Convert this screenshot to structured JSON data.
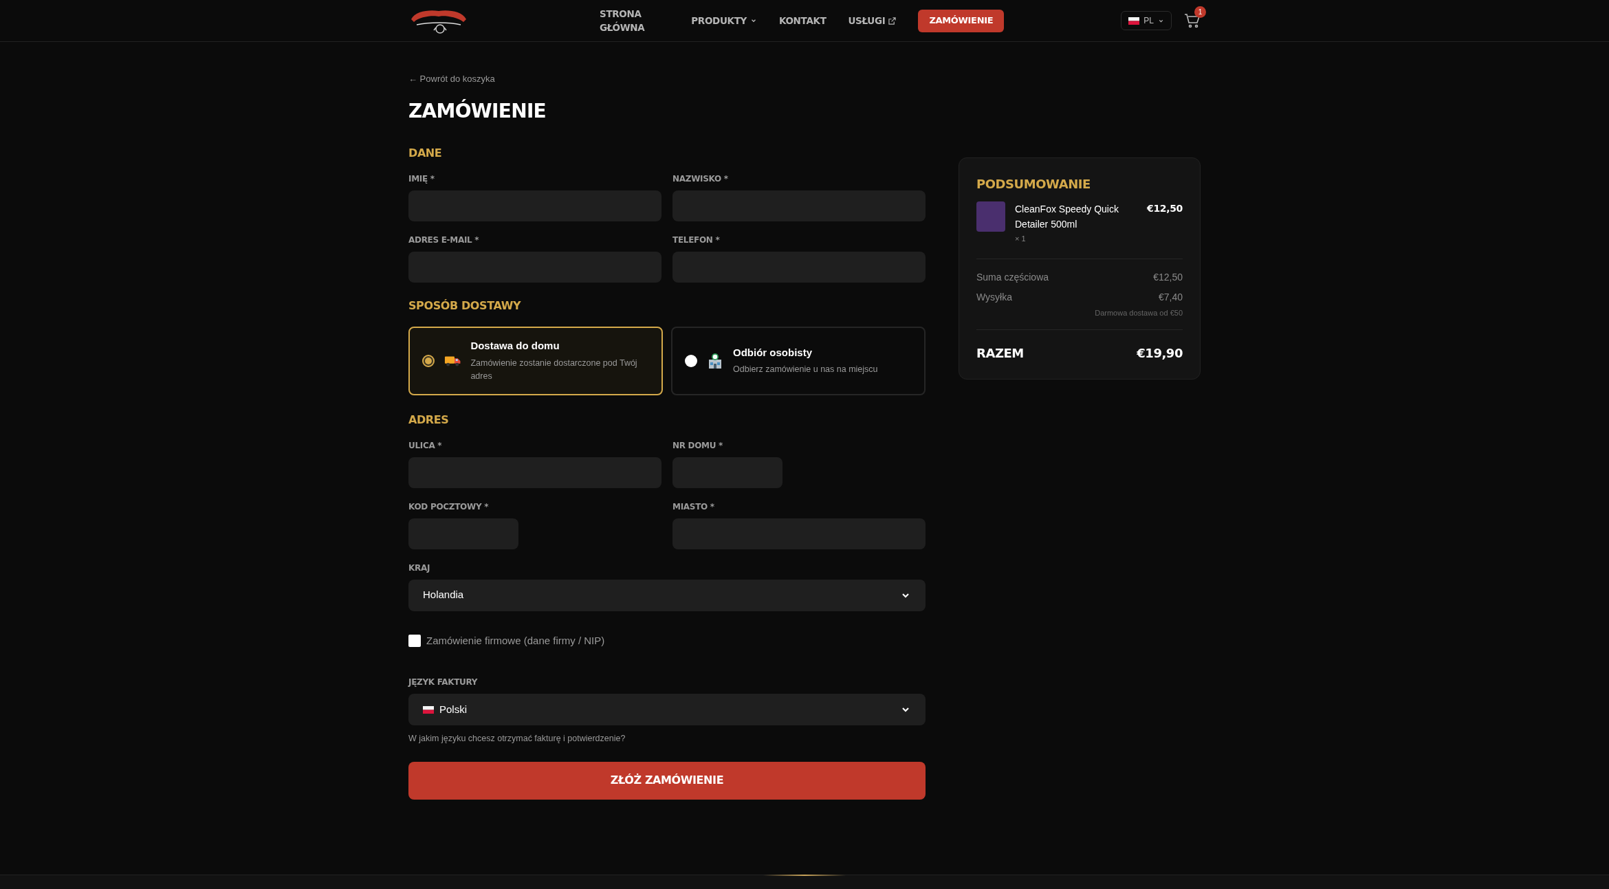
{
  "header": {
    "nav": [
      {
        "label": "STRONA GŁÓWNA",
        "kind": "link"
      },
      {
        "label": "PRODUKTY",
        "kind": "dropdown"
      },
      {
        "label": "KONTAKT",
        "kind": "link"
      },
      {
        "label": "USŁUGI",
        "kind": "external"
      }
    ],
    "order_button": "ZAMÓWIENIE",
    "language": "PL",
    "cart_count": "1"
  },
  "back_link": "← Powrót do koszyka",
  "title": "ZAMÓWIENIE",
  "personal": {
    "heading": "DANE",
    "fields": [
      {
        "label": "IMIĘ *",
        "kind": "full"
      },
      {
        "label": "NAZWISKO *",
        "kind": "full"
      },
      {
        "label": "ADRES E-MAIL *",
        "kind": "full"
      },
      {
        "label": "TELEFON *",
        "kind": "full"
      }
    ]
  },
  "delivery": {
    "heading": "SPOSÓB DOSTAWY",
    "options": [
      {
        "kind": "truck",
        "title": "Dostawa do domu",
        "description": "Zamówienie zostanie dostarczone pod Twój adres",
        "selected": true
      },
      {
        "kind": "store",
        "title": "Odbiór osobisty",
        "description": "Odbierz zamówienie u nas na miejscu",
        "selected": false
      }
    ]
  },
  "address": {
    "heading": "ADRES",
    "fields": [
      {
        "label": "ULICA *",
        "kind": "full"
      },
      {
        "label": "NR DOMU *",
        "kind": "short"
      },
      {
        "label": "KOD POCZTOWY *",
        "kind": "short"
      },
      {
        "label": "MIASTO *",
        "kind": "full"
      }
    ],
    "country": {
      "label": "KRAJ",
      "value": "Holandia"
    }
  },
  "company_order": {
    "label": "Zamówienie firmowe (dane firmy / NIP)",
    "checked": false
  },
  "invoice_language": {
    "label": "JĘZYK FAKTURY",
    "value": "Polski",
    "hint": "W jakim języku chcesz otrzymać fakturę i potwierdzenie?"
  },
  "submit": "ZŁÓŻ ZAMÓWIENIE",
  "summary": {
    "title": "PODSUMOWANIE",
    "items": [
      {
        "name": "CleanFox Speedy Quick Detailer 500ml",
        "quantity": "× 1",
        "price": "€12,50"
      }
    ],
    "rows": [
      {
        "label": "Suma częściowa",
        "value": "€12,50"
      },
      {
        "label": "Wysyłka",
        "value": "€7,40"
      }
    ],
    "shipping_note": "Darmowa dostawa od €50",
    "total_label": "RAZEM",
    "total": "€19,90"
  }
}
